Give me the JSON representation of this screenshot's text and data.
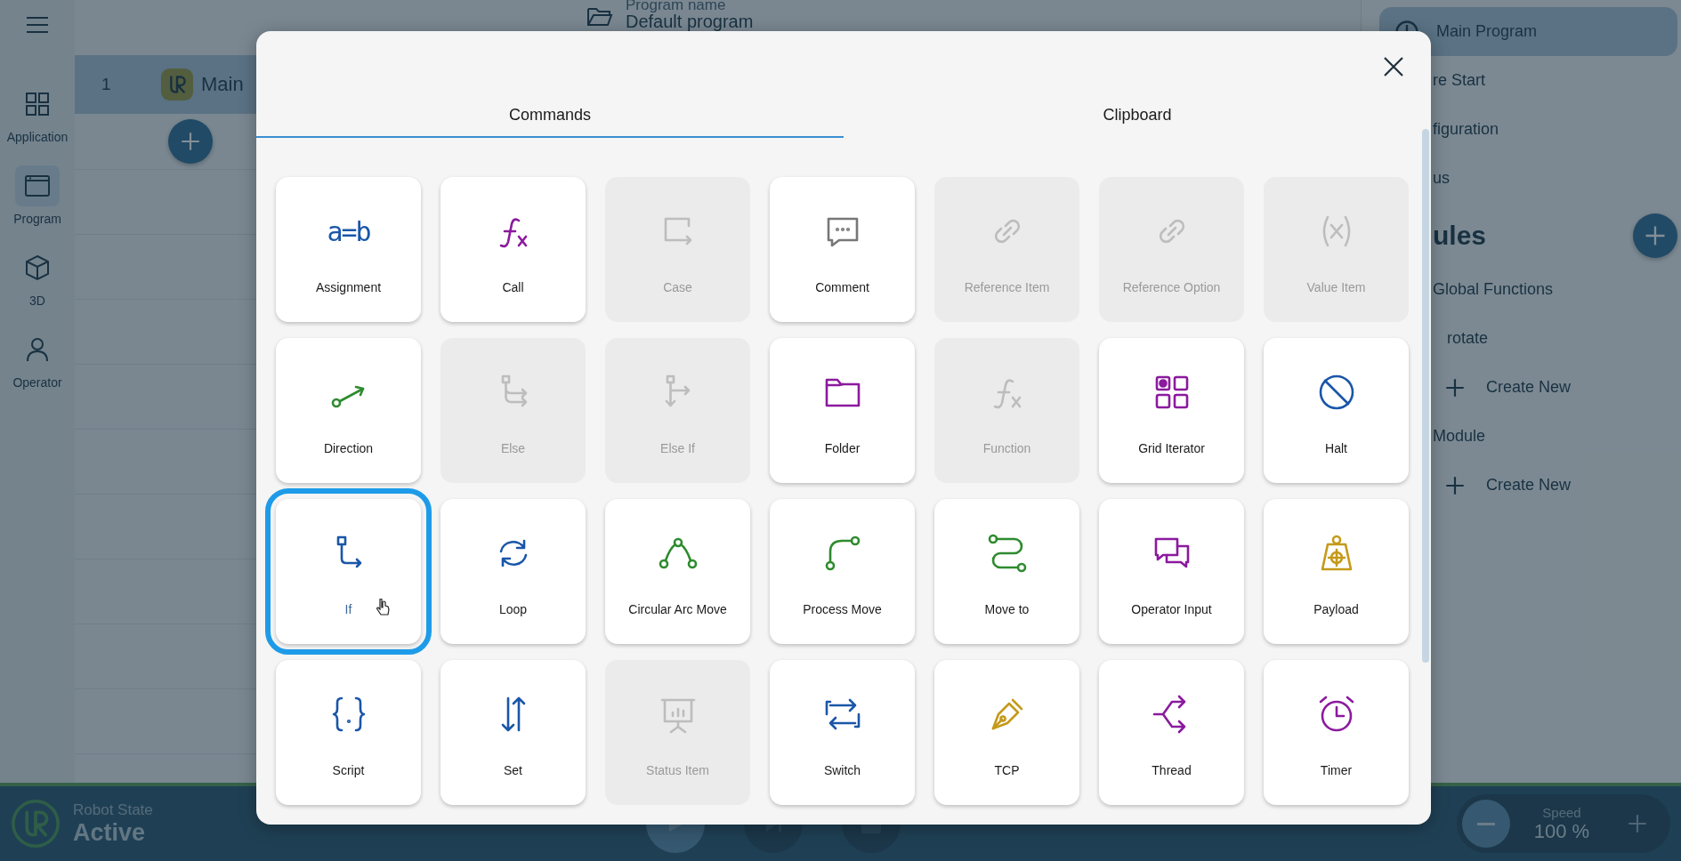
{
  "nav_rail": {
    "items": [
      {
        "kind": "apps",
        "label": "Application",
        "selected": false
      },
      {
        "kind": "program",
        "label": "Program",
        "selected": true
      },
      {
        "kind": "cube",
        "label": "3D",
        "selected": false
      },
      {
        "kind": "person",
        "label": "Operator",
        "selected": false
      }
    ]
  },
  "header": {
    "program_name_label": "Program name",
    "program_name": "Default program"
  },
  "program_tree": {
    "rows": [
      {
        "number": "1",
        "label": "Main",
        "selected": true
      }
    ]
  },
  "side_panel": {
    "items": [
      {
        "label": "Main Program",
        "selected": true
      },
      {
        "label": "re Start",
        "selected": false
      },
      {
        "label": "figuration",
        "selected": false
      },
      {
        "label": "us",
        "selected": false
      }
    ],
    "modules": {
      "title": "ules",
      "groups": [
        {
          "label": "Global Functions",
          "children": [
            {
              "label": "rotate"
            }
          ],
          "create_label": "Create New"
        },
        {
          "label": "Module",
          "create_label": "Create New"
        }
      ]
    }
  },
  "dialog": {
    "tabs": [
      {
        "label": "Commands",
        "selected": true
      },
      {
        "label": "Clipboard",
        "selected": false
      }
    ],
    "commands": [
      {
        "kind": "assignment",
        "label": "Assignment",
        "icon_text": "a=b",
        "color": "#1a56a8",
        "disabled": false,
        "selected": false
      },
      {
        "kind": "call",
        "label": "Call",
        "color": "#8b1a9e",
        "disabled": false,
        "selected": false
      },
      {
        "kind": "case",
        "label": "Case",
        "disabled": true,
        "selected": false
      },
      {
        "kind": "comment",
        "label": "Comment",
        "color": "#777777",
        "disabled": false,
        "selected": false
      },
      {
        "kind": "link",
        "label": "Reference Item",
        "disabled": true,
        "selected": false
      },
      {
        "kind": "link",
        "label": "Reference Option",
        "disabled": true,
        "selected": false
      },
      {
        "kind": "value",
        "label": "Value Item",
        "disabled": true,
        "selected": false
      },
      {
        "kind": "direction",
        "label": "Direction",
        "color": "#2e8b2e",
        "disabled": false,
        "selected": false
      },
      {
        "kind": "else",
        "label": "Else",
        "disabled": true,
        "selected": false
      },
      {
        "kind": "elseif",
        "label": "Else If",
        "disabled": true,
        "selected": false
      },
      {
        "kind": "folder",
        "label": "Folder",
        "color": "#8b1a9e",
        "disabled": false,
        "selected": false
      },
      {
        "kind": "call",
        "label": "Function",
        "disabled": true,
        "selected": false
      },
      {
        "kind": "grid",
        "label": "Grid Iterator",
        "color": "#8b1a9e",
        "disabled": false,
        "selected": false
      },
      {
        "kind": "halt",
        "label": "Halt",
        "color": "#1a56a8",
        "disabled": false,
        "selected": false
      },
      {
        "kind": "if",
        "label": "If",
        "color": "#1a56a8",
        "disabled": false,
        "selected": true
      },
      {
        "kind": "loop",
        "label": "Loop",
        "color": "#1a56a8",
        "disabled": false,
        "selected": false
      },
      {
        "kind": "arc",
        "label": "Circular Arc Move",
        "color": "#2e8b2e",
        "disabled": false,
        "selected": false
      },
      {
        "kind": "process",
        "label": "Process Move",
        "color": "#2e8b2e",
        "disabled": false,
        "selected": false
      },
      {
        "kind": "moveto",
        "label": "Move to",
        "color": "#2e8b2e",
        "disabled": false,
        "selected": false
      },
      {
        "kind": "input",
        "label": "Operator Input",
        "color": "#8b1a9e",
        "disabled": false,
        "selected": false
      },
      {
        "kind": "payload",
        "label": "Payload",
        "color": "#c49a1a",
        "disabled": false,
        "selected": false
      },
      {
        "kind": "script",
        "label": "Script",
        "color": "#1a56a8",
        "disabled": false,
        "selected": false
      },
      {
        "kind": "set",
        "label": "Set",
        "color": "#1a56a8",
        "disabled": false,
        "selected": false
      },
      {
        "kind": "status",
        "label": "Status Item",
        "disabled": true,
        "selected": false
      },
      {
        "kind": "switch",
        "label": "Switch",
        "color": "#1a56a8",
        "disabled": false,
        "selected": false
      },
      {
        "kind": "tcp",
        "label": "TCP",
        "color": "#c49a1a",
        "disabled": false,
        "selected": false
      },
      {
        "kind": "thread",
        "label": "Thread",
        "color": "#8b1a9e",
        "disabled": false,
        "selected": false
      },
      {
        "kind": "timer",
        "label": "Timer",
        "color": "#8b1a9e",
        "disabled": false,
        "selected": false
      }
    ]
  },
  "status_bar": {
    "robot_state_label": "Robot State",
    "robot_state": "Active",
    "speed_label": "Speed",
    "speed": "100 %"
  }
}
